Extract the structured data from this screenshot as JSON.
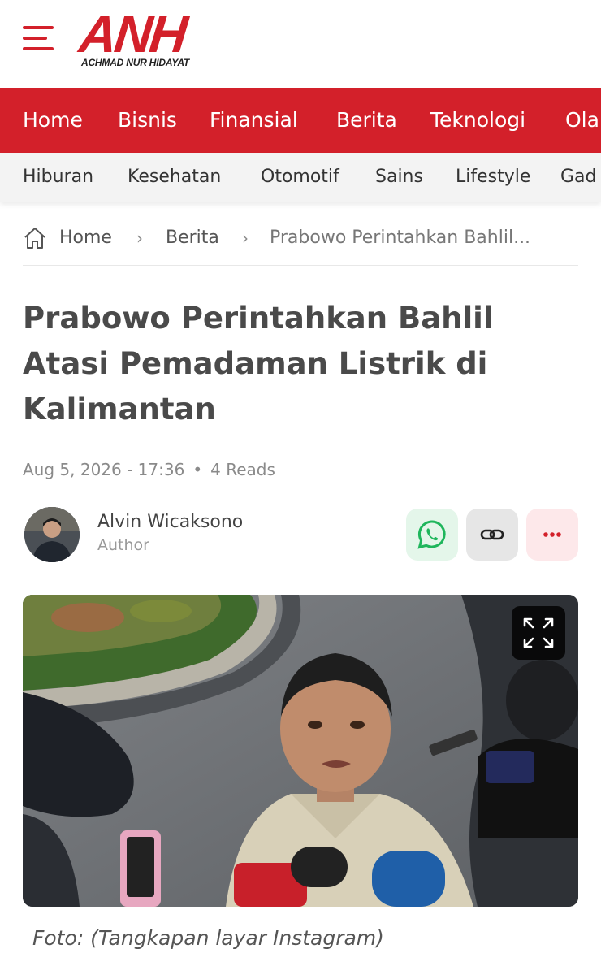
{
  "header": {
    "logo_mark": "ANH",
    "logo_sub": "ACHMAD NUR HIDAYAT",
    "brand_color": "#d3202a"
  },
  "nav_primary": [
    "Home",
    "Bisnis",
    "Finansial",
    "Berita",
    "Teknologi",
    "Ola"
  ],
  "nav_secondary": [
    "Hiburan",
    "Kesehatan",
    "Otomotif",
    "Sains",
    "Lifestyle",
    "Gad"
  ],
  "breadcrumb": {
    "home": "Home",
    "section": "Berita",
    "current": "Prabowo Perintahkan Bahlil..."
  },
  "article": {
    "title": "Prabowo Perintahkan Bahlil Atasi Pemadaman Listrik di Kalimantan",
    "date": "Aug 5, 2026 - 17:36",
    "reads": "4 Reads",
    "author_name": "Alvin Wicaksono",
    "author_role": "Author",
    "caption": "Foto: (Tangkapan layar Instagram)"
  },
  "share_icons": [
    "whatsapp-icon",
    "link-icon",
    "more-icon"
  ]
}
